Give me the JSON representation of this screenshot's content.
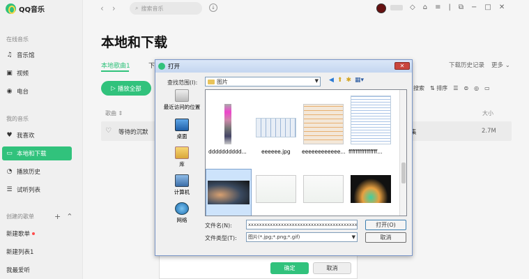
{
  "app": {
    "name": "QQ音乐"
  },
  "sidebar": {
    "online_title": "在线音乐",
    "online_items": [
      {
        "label": "音乐馆",
        "icon": "music-note-icon"
      },
      {
        "label": "视频",
        "icon": "video-icon"
      },
      {
        "label": "电台",
        "icon": "radio-icon"
      }
    ],
    "mine_title": "我的音乐",
    "mine_items": [
      {
        "label": "我喜欢",
        "icon": "heart-icon"
      },
      {
        "label": "本地和下载",
        "icon": "monitor-icon"
      },
      {
        "label": "播放历史",
        "icon": "history-icon"
      },
      {
        "label": "试听列表",
        "icon": "list-icon"
      }
    ],
    "created_title": "创建的歌单",
    "playlists": [
      "新建歌单",
      "新建列表1",
      "我最爱听"
    ]
  },
  "topbar": {
    "search_placeholder": "搜索音乐"
  },
  "main": {
    "title": "本地和下载",
    "tabs": [
      "本地歌曲1",
      "下"
    ],
    "right_links": [
      "下载历史记录",
      "更多"
    ],
    "play_all": "播放全部",
    "tools": [
      "搜索",
      "排序"
    ],
    "columns": {
      "song": "歌曲",
      "size": "大小"
    },
    "songs": [
      {
        "name": "等待的沉默",
        "extra": "集",
        "size": "2.7M"
      }
    ]
  },
  "back_panel": {
    "ok": "确定",
    "cancel": "取消"
  },
  "dialog": {
    "title": "打开",
    "look_in_label": "查找范围(I):",
    "look_in_value": "图片",
    "places": [
      "最近访问的位置",
      "桌面",
      "库",
      "计算机",
      "网络"
    ],
    "files": [
      "dddddddddd...",
      "eeeeee.jpg",
      "eeeeeeeeeeee...",
      "ffffffffffffffff..."
    ],
    "file_name_label": "文件名(N):",
    "file_name_value": "xxxxxxxxxxxxxxxxxxxxxxxxxxxxxxxxxxxxxxxxx",
    "file_type_label": "文件类型(T):",
    "file_type_value": "图片(*.jpg;*.png;*.gif)",
    "open_button": "打开(O)",
    "cancel_button": "取消"
  },
  "colors": {
    "accent": "#31c27c"
  }
}
